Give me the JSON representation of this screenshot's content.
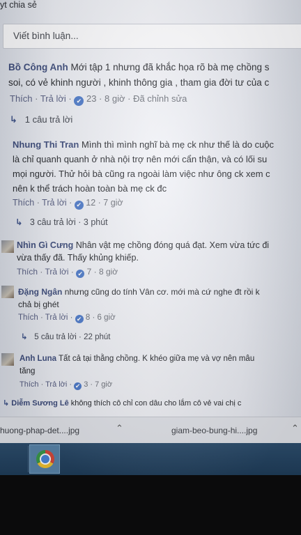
{
  "top_text": "yt chia sẻ",
  "comment_input": {
    "placeholder": "Viết bình luận..."
  },
  "comments": [
    {
      "author": "Bồ Công Anh",
      "line1": "Mới tập 1 nhưng đã khắc họa rõ bà mẹ chồng s",
      "line2": "soi, có vẻ khinh người , khinh thông gia , tham gia đời tư của c",
      "like": "Thích",
      "reply": "Trả lời",
      "count": "23",
      "time": "8 giờ",
      "edited": "Đã chỉnh sửa",
      "replies": "1 câu trả lời"
    },
    {
      "author": "Nhung Thi Tran",
      "line1": "Mình thì mình nghĩ bà mẹ ck như thế là do cuộc",
      "line2": "là chỉ quanh quanh ở nhà nội trợ nên mới cẩn thận, và có lối su",
      "line3": "mọi người. Thử hỏi bà cũng ra ngoài làm việc như ông ck xem c",
      "line4": "nên k thể trách hoàn toàn bà mẹ ck đc",
      "like": "Thích",
      "reply": "Trả lời",
      "count": "12",
      "time": "7 giờ",
      "replies": "3 câu trả lời",
      "replies_time": "3 phút"
    },
    {
      "author": "Nhìn Gì Cưng",
      "line1": "Nhân vật mẹ chồng đóng quá đạt. Xem vừa tức đi",
      "line2": "vừa thấy đã. Thấy khủng khiếp.",
      "like": "Thích",
      "reply": "Trả lời",
      "count": "7",
      "time": "8 giờ"
    },
    {
      "author": "Đặng Ngân",
      "line1": "nhưng cũng do tính Vân cơ. mới mà cứ nghe đt rồi k",
      "line2": "chả bị ghét",
      "like": "Thích",
      "reply": "Trả lời",
      "count": "8",
      "time": "6 giờ",
      "replies": "5 câu trả lời",
      "replies_time": "22 phút"
    },
    {
      "author": "Anh Luna",
      "line1": "Tất cả tại thằng chồng. K khéo giữa mẹ và vợ nên mâu",
      "line2": "tăng",
      "like": "Thích",
      "reply": "Trả lời",
      "count": "3",
      "time": "7 giờ"
    },
    {
      "author": "Diễm Sương Lê",
      "line1": "không thích cô chỉ con dâu cho lắm cô vẻ vai chị c"
    }
  ],
  "downloads": [
    {
      "name": "huong-phap-det....jpg"
    },
    {
      "name": "giam-beo-bung-hi....jpg"
    }
  ],
  "colors": {
    "author": "#3b4a7a",
    "like_badge": "#4a78c9",
    "taskbar": "#2d4e6e"
  },
  "icons": [
    "reply-arrow-icon",
    "like-icon",
    "chevron-up-icon",
    "chrome-icon"
  ]
}
